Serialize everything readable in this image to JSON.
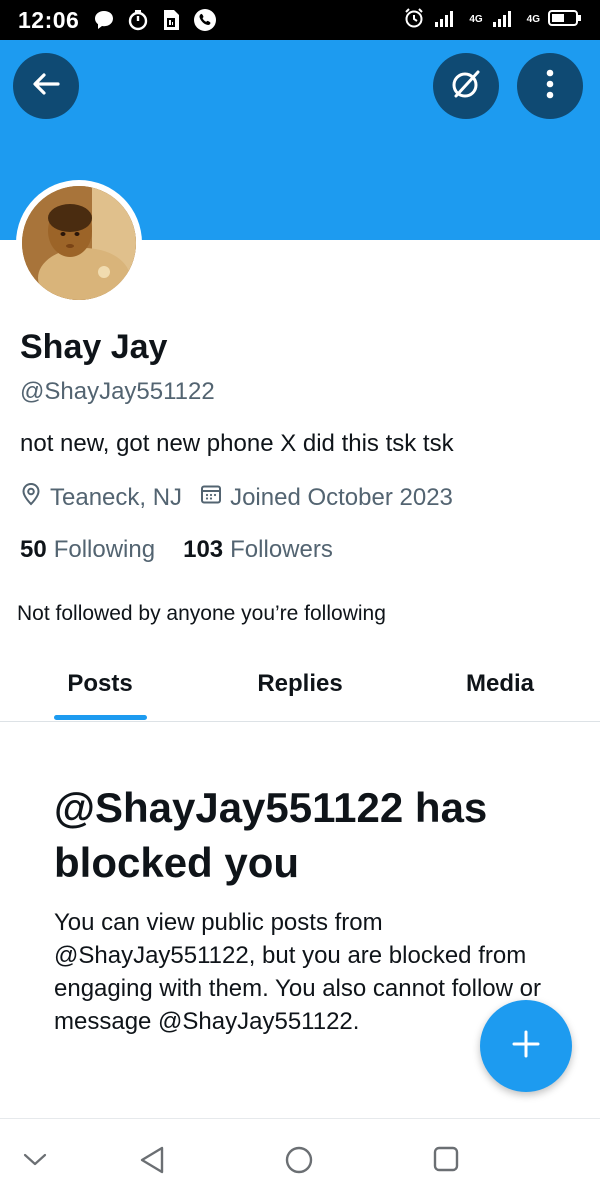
{
  "status_bar": {
    "time": "12:06",
    "left_icons": [
      "chat-bubble-icon",
      "timer-icon",
      "sim-icon",
      "viber-icon"
    ],
    "right_icons": [
      "alarm-icon",
      "signal-icon",
      "signal-icon",
      "battery-icon"
    ],
    "network_1": "4G",
    "network_2": "4G"
  },
  "header": {
    "banner_color": "#1d9bf0",
    "back_icon": "arrow-left-icon",
    "grok_icon": "grok-icon",
    "more_icon": "more-vertical-icon"
  },
  "profile": {
    "display_name": "Shay Jay",
    "handle": "@ShayJay551122",
    "bio": "not new, got new phone X did this tsk tsk",
    "location": "Teaneck, NJ",
    "joined": "Joined October 2023",
    "following_count": "50",
    "following_label": "Following",
    "followers_count": "103",
    "followers_label": "Followers",
    "followed_by_text": "Not followed by anyone you’re following"
  },
  "tabs": [
    {
      "label": "Posts",
      "active": true
    },
    {
      "label": "Replies",
      "active": false
    },
    {
      "label": "Media",
      "active": false
    }
  ],
  "blocked": {
    "title": "@ShayJay551122 has blocked you",
    "body": "You can view public posts from @ShayJay551122, but you are blocked from engaging with them. You also cannot follow or message @ShayJay551122."
  },
  "fab": {
    "icon": "plus-icon",
    "color": "#1d9bf0"
  },
  "nav_bar": {
    "icons": [
      "chevron-down-icon",
      "back-triangle-icon",
      "home-circle-icon",
      "recents-square-icon"
    ]
  }
}
